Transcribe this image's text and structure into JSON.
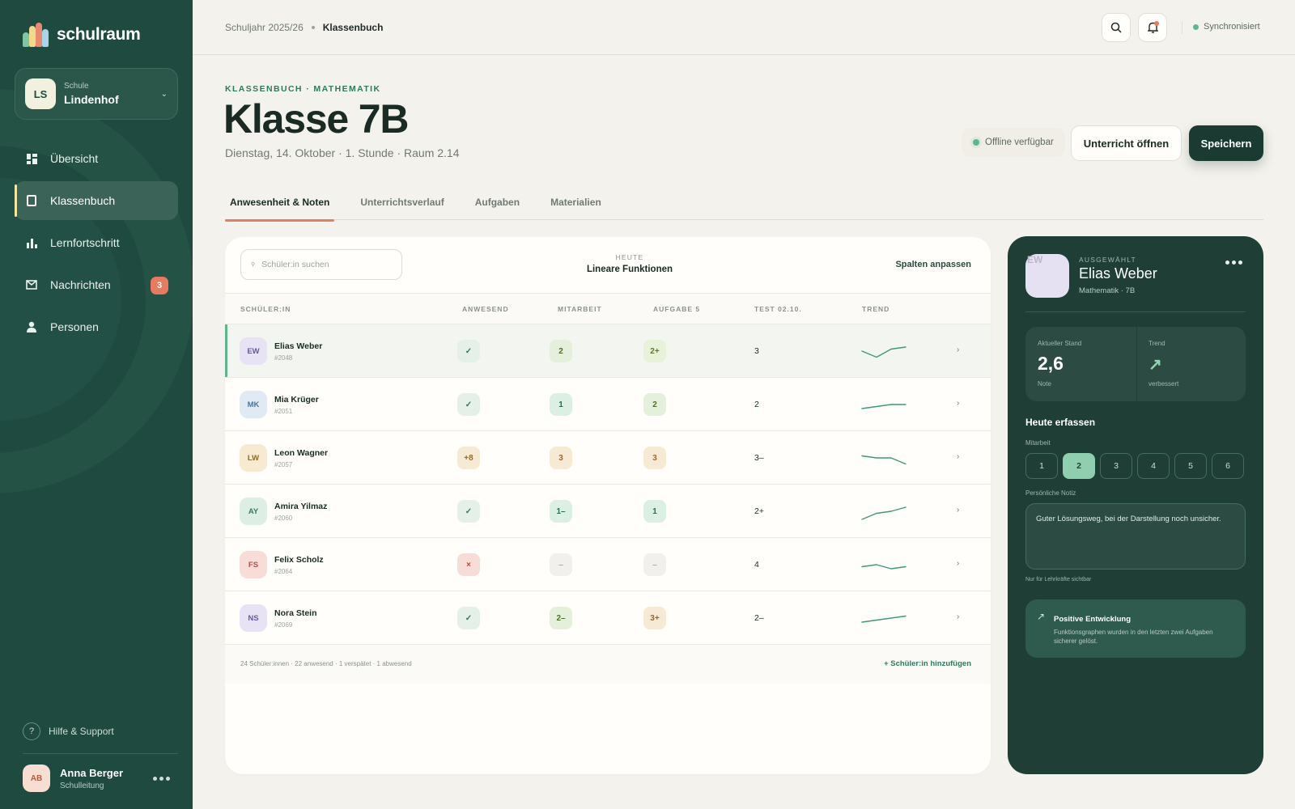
{
  "brand": {
    "name": "schulraum"
  },
  "school": {
    "initials": "LS",
    "label": "Schule",
    "name": "Lindenhof"
  },
  "nav": [
    {
      "label": "Übersicht",
      "icon": "dashboard-icon"
    },
    {
      "label": "Klassenbuch",
      "icon": "book-icon",
      "active": true
    },
    {
      "label": "Lernfortschritt",
      "icon": "bar-chart-icon"
    },
    {
      "label": "Nachrichten",
      "icon": "mail-icon",
      "badge": "3"
    },
    {
      "label": "Personen",
      "icon": "person-icon"
    }
  ],
  "help": {
    "label": "Hilfe & Support",
    "icon_glyph": "?"
  },
  "user": {
    "initials": "AB",
    "name": "Anna Berger",
    "role": "Schulleitung"
  },
  "topbar": {
    "breadcrumb_parent": "Schuljahr 2025/26",
    "breadcrumb_current": "Klassenbuch",
    "sync_status": "Synchronisiert"
  },
  "header": {
    "eyebrow": "KLASSENBUCH · MATHEMATIK",
    "title": "Klasse 7B",
    "subtitle": "Dienstag, 14. Oktober · 1. Stunde · Raum 2.14",
    "offline": "Offline verfügbar",
    "open_lesson": "Unterricht öffnen",
    "save": "Speichern"
  },
  "tabs": [
    "Anwesenheit & Noten",
    "Unterrichtsverlauf",
    "Aufgaben",
    "Materialien"
  ],
  "table": {
    "search_placeholder": "Schüler:in suchen",
    "today_label": "HEUTE",
    "today_topic": "Lineare Funktionen",
    "columns_link": "Spalten anpassen",
    "headers": [
      "SCHÜLER:IN",
      "ANWESEND",
      "MITARBEIT",
      "AUFGABE 5",
      "TEST 02.10.",
      "TREND"
    ],
    "rows": [
      {
        "initials": "EW",
        "name": "Elias Weber",
        "id": "#2048",
        "attendance": "✓",
        "participation": "2",
        "task": "2+",
        "test": "3",
        "trend": [
          2,
          5,
          1,
          0
        ]
      },
      {
        "initials": "MK",
        "name": "Mia Krüger",
        "id": "#2051",
        "attendance": "✓",
        "participation": "1",
        "task": "2",
        "test": "2",
        "trend": [
          4,
          3,
          2,
          2
        ]
      },
      {
        "initials": "LW",
        "name": "Leon Wagner",
        "id": "#2057",
        "attendance": "+8",
        "participation": "3",
        "task": "3",
        "test": "3–",
        "trend": [
          1,
          2,
          2,
          5
        ]
      },
      {
        "initials": "AY",
        "name": "Amira Yilmaz",
        "id": "#2060",
        "attendance": "✓",
        "participation": "1–",
        "task": "1",
        "test": "2+",
        "trend": [
          6,
          3,
          2,
          0
        ]
      },
      {
        "initials": "FS",
        "name": "Felix Scholz",
        "id": "#2064",
        "attendance": "×",
        "participation": "–",
        "task": "–",
        "test": "4",
        "trend": [
          3,
          2,
          4,
          3
        ]
      },
      {
        "initials": "NS",
        "name": "Nora Stein",
        "id": "#2069",
        "attendance": "✓",
        "participation": "2–",
        "task": "3+",
        "test": "2–",
        "trend": [
          4,
          3,
          2,
          1
        ]
      }
    ],
    "summary": "24 Schüler:innen · 22 anwesend · 1 verspätet · 1 abwesend",
    "add_label": "+ Schüler:in hinzufügen"
  },
  "panel": {
    "initials": "EW",
    "label": "AUSGEWÄHLT",
    "name": "Elias Weber",
    "subtitle": "Mathematik · 7B",
    "current_label": "Aktueller Stand",
    "current_value": "2,6",
    "current_foot": "Note",
    "trend_label": "Trend",
    "trend_foot": "verbessert",
    "section_title": "Heute erfassen",
    "participation_label": "Mitarbeit",
    "grades": [
      "1",
      "2",
      "3",
      "4",
      "5",
      "6"
    ],
    "selected_grade": "2",
    "note_label": "Persönliche Notiz",
    "note_text": "Guter Lösungsweg, bei der Darstellung noch unsicher.",
    "note_hint": "Nur für Lehrkräfte sichtbar",
    "dev_title": "Positive Entwicklung",
    "dev_text": "Funktionsgraphen wurden in den letzten zwei Aufgaben sicherer gelöst."
  },
  "colors": {
    "sidebar": "#1f4a3f",
    "accent": "#e57b60",
    "success": "#5fb58c",
    "panel": "#1f3f36"
  }
}
